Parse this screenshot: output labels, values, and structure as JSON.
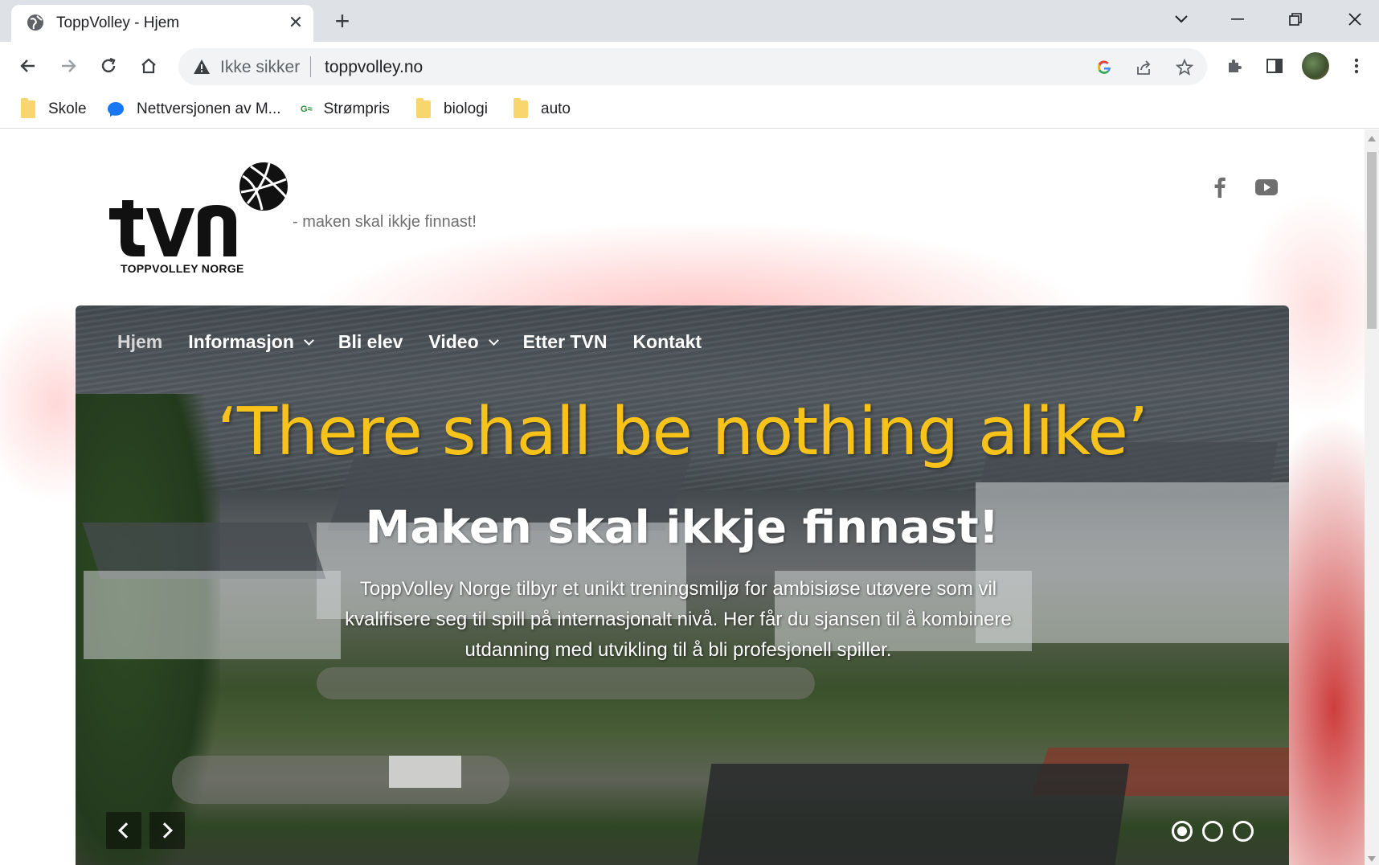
{
  "browser": {
    "tab_title": "ToppVolley - Hjem",
    "security_label": "Ikke sikker",
    "url": "toppvolley.no",
    "bookmarks": [
      {
        "label": "Skole",
        "icon": "folder-icon"
      },
      {
        "label": "Nettversjonen av M...",
        "icon": "messenger-icon"
      },
      {
        "label": "Strømpris",
        "icon": "strompris-icon"
      },
      {
        "label": "biologi",
        "icon": "folder-icon"
      },
      {
        "label": "auto",
        "icon": "folder-icon"
      }
    ]
  },
  "site": {
    "logo_text": "TOPPVOLLEY NORGE",
    "tagline": "- maken skal ikkje finnast!",
    "nav": [
      {
        "label": "Hjem",
        "active": true,
        "dropdown": false
      },
      {
        "label": "Informasjon",
        "active": false,
        "dropdown": true
      },
      {
        "label": "Bli elev",
        "active": false,
        "dropdown": false
      },
      {
        "label": "Video",
        "active": false,
        "dropdown": true
      },
      {
        "label": "Etter TVN",
        "active": false,
        "dropdown": false
      },
      {
        "label": "Kontakt",
        "active": false,
        "dropdown": false
      }
    ],
    "hero": {
      "quote": "‘There shall be nothing alike’",
      "title": "Maken skal ikkje finnast!",
      "text": "ToppVolley Norge tilbyr et unikt treningsmiljø for ambisiøse utøvere som vil kvalifisere seg til spill på internasjonalt nivå. Her får du sjansen til å kombinere utdanning med utvikling til å bli profesjonell spiller.",
      "slides_total": 3,
      "active_slide": 1
    },
    "colors": {
      "quote": "#f7c31a",
      "accent_red": "#c82828"
    }
  }
}
